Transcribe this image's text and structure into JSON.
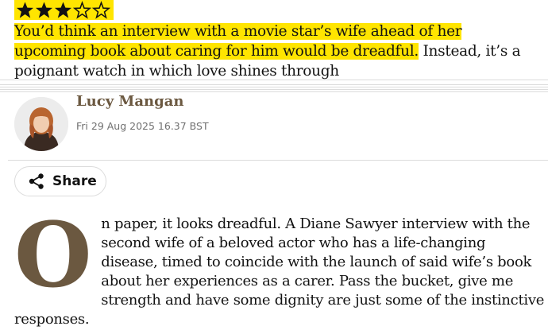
{
  "rating": {
    "value": 3,
    "max": 5,
    "star_color": "#121212",
    "badge_color": "#ffe500"
  },
  "standfirst": {
    "highlighted": "You’d think an interview with a movie star’s wife ahead of her upcoming book about caring for him would be dreadful.",
    "rest": " Instead, it’s a poignant watch in which love shines through"
  },
  "author": {
    "name": "Lucy Mangan",
    "date": "Fri 29 Aug 2025 16.37 BST"
  },
  "share": {
    "label": "Share",
    "icon": "share-icon"
  },
  "article": {
    "drop_cap": "O",
    "text": "n paper, it looks dreadful. A Diane Sawyer interview with the second wife of a beloved actor who has a life-changing disease, timed to coincide with the launch of said wife’s book about her experiences as a carer. Pass the bucket, give me strength and have some dignity are just some of the instinctive responses."
  },
  "colors": {
    "accent": "#6b5840",
    "highlight": "#ffe500"
  }
}
